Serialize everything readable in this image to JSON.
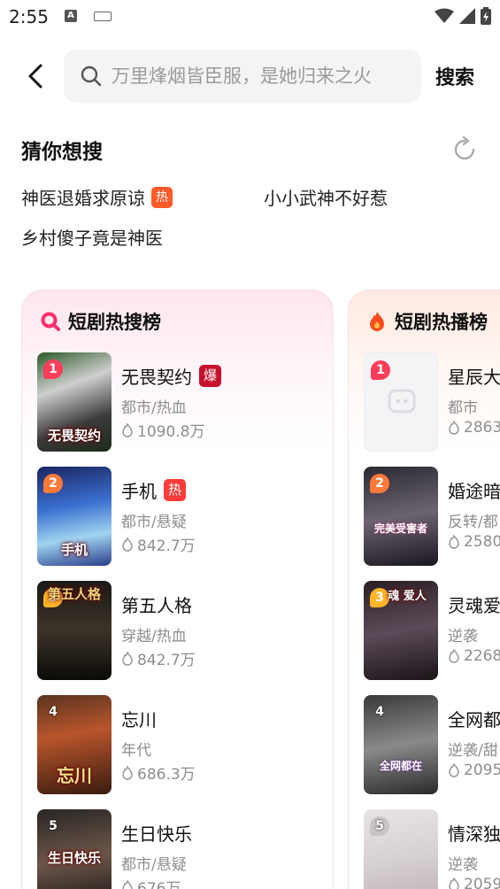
{
  "status": {
    "time": "2:55"
  },
  "search": {
    "placeholder": "万里烽烟皆臣服，是她归来之火",
    "button": "搜索"
  },
  "guess": {
    "title": "猜你想搜",
    "items": [
      {
        "label": "神医退婚求原谅",
        "tag": "热"
      },
      {
        "label": "小小武神不好惹"
      },
      {
        "label": "乡村傻子竟是神医"
      }
    ]
  },
  "hot_search": {
    "title": "短剧热搜榜",
    "items": [
      {
        "rank": "1",
        "title": "无畏契约",
        "tag": "爆",
        "genre": "都市/热血",
        "heat": "1090.8万",
        "cover_text": "无畏契约"
      },
      {
        "rank": "2",
        "title": "手机",
        "tag": "热",
        "genre": "都市/悬疑",
        "heat": "842.7万",
        "cover_text": "手机"
      },
      {
        "rank": "3",
        "title": "第五人格",
        "genre": "穿越/热血",
        "heat": "842.7万",
        "cover_text": "第五人格"
      },
      {
        "rank": "4",
        "title": "忘川",
        "genre": "年代",
        "heat": "686.3万",
        "cover_text": "忘川"
      },
      {
        "rank": "5",
        "title": "生日快乐",
        "genre": "都市/悬疑",
        "heat": "676万",
        "cover_text": "生日快乐"
      }
    ]
  },
  "hot_play": {
    "title": "短剧热播榜",
    "items": [
      {
        "rank": "1",
        "title": "星辰大",
        "genre": "都市",
        "heat": "2863"
      },
      {
        "rank": "2",
        "title": "婚途暗",
        "genre": "反转/都",
        "heat": "2580",
        "cover_text": "完美受害者"
      },
      {
        "rank": "3",
        "title": "灵魂爱",
        "genre": "逆袭",
        "heat": "2268",
        "cover_text": "魂 爱人"
      },
      {
        "rank": "4",
        "title": "全网都",
        "genre": "逆袭/甜",
        "heat": "2095",
        "cover_text": "全网都在"
      },
      {
        "rank": "5",
        "title": "情深独",
        "genre": "逆袭",
        "heat": "2059"
      }
    ]
  }
}
